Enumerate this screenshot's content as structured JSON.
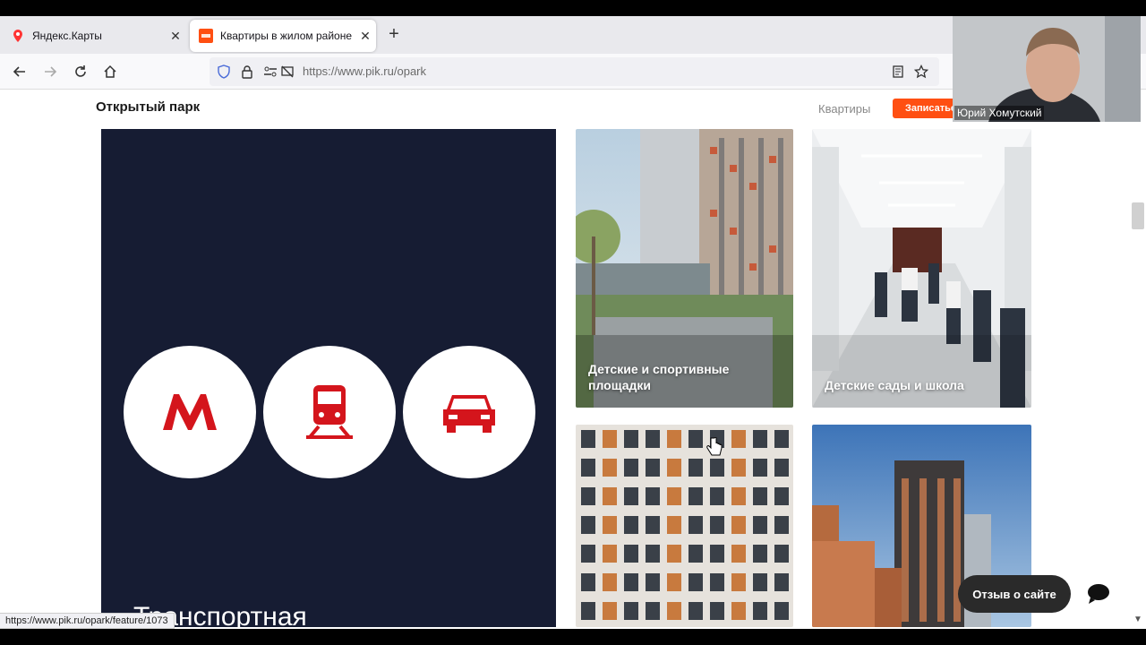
{
  "browser": {
    "tabs": [
      {
        "label": "Яндекс.Карты",
        "favicon": "map-pin-icon",
        "close": "✕"
      },
      {
        "label": "Квартиры в жилом районе От",
        "favicon": "pik-logo-icon",
        "close": "✕"
      }
    ],
    "new_tab": "+",
    "url": "https://www.pik.ru/opark",
    "status_url": "https://www.pik.ru/opark/feature/1073"
  },
  "site": {
    "title": "Открытый парк",
    "nav_apartments": "Квартиры",
    "cta_label": "Записаться",
    "accent": "#ff4f12"
  },
  "main": {
    "panel_text": "Транспортная",
    "transport_icons": [
      "metro-icon",
      "train-icon",
      "car-icon"
    ],
    "cards": [
      {
        "caption": "Детские и спортивные площадки"
      },
      {
        "caption": "Детские сады и школа"
      },
      {
        "caption": ""
      },
      {
        "caption": ""
      }
    ]
  },
  "feedback_label": "Отзыв о сайте",
  "webcam": {
    "name": "Юрий Хомутский"
  }
}
